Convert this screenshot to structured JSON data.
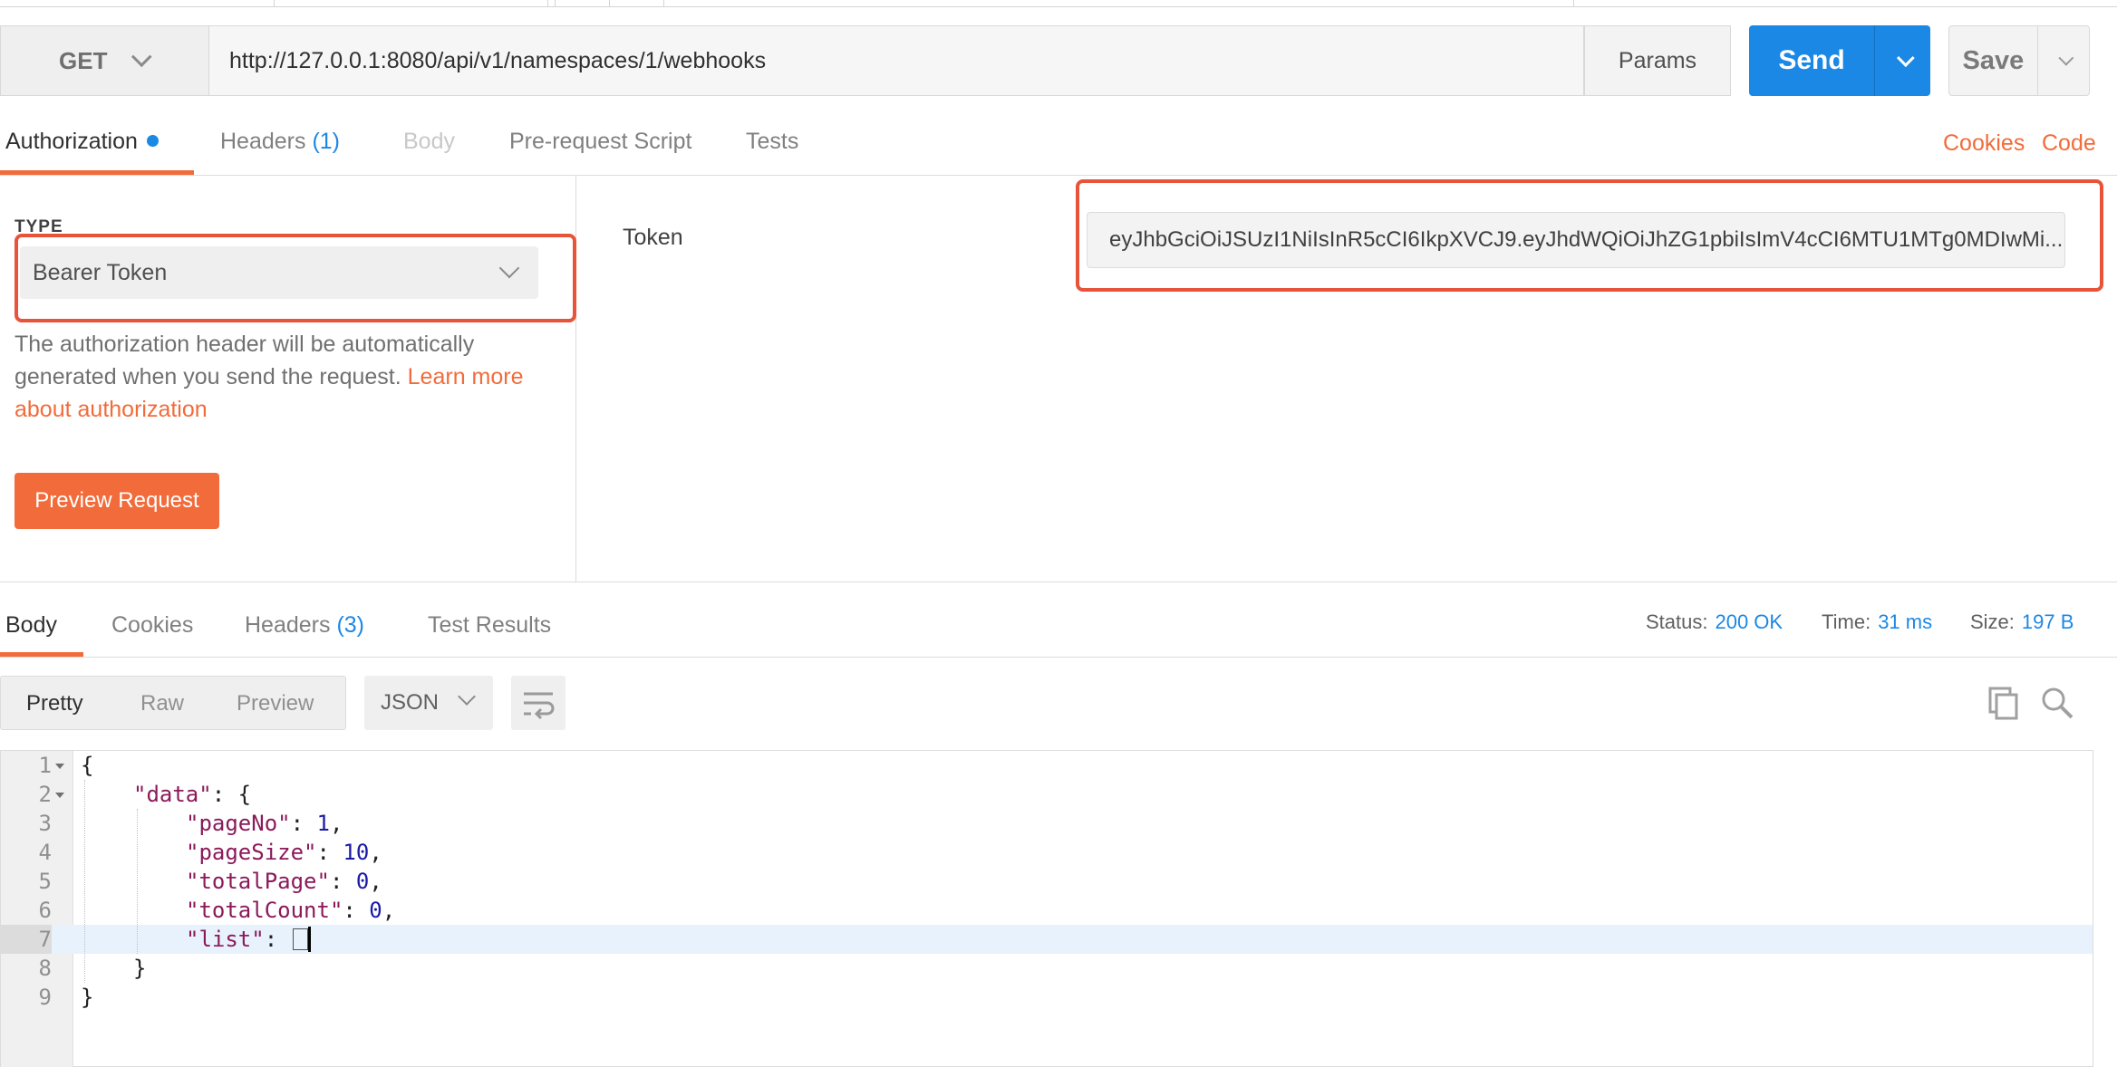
{
  "request": {
    "method": "GET",
    "url": "http://127.0.0.1:8080/api/v1/namespaces/1/webhooks",
    "params_label": "Params",
    "send_label": "Send",
    "save_label": "Save"
  },
  "request_tabs": {
    "authorization": "Authorization",
    "headers": "Headers",
    "headers_count": "(1)",
    "body": "Body",
    "prerequest": "Pre-request Script",
    "tests": "Tests",
    "cookies": "Cookies",
    "code": "Code"
  },
  "auth": {
    "type_label": "TYPE",
    "type_value": "Bearer Token",
    "description": "The authorization header will be automatically generated when you send the request.",
    "learn_more": "Learn more about authorization",
    "preview_label": "Preview Request",
    "token_label": "Token",
    "token_value": "eyJhbGciOiJSUzI1NiIsInR5cCI6IkpXVCJ9.eyJhdWQiOiJhZG1pbiIsImV4cCI6MTU1MTg0MDIwMi..."
  },
  "response_tabs": {
    "body": "Body",
    "cookies": "Cookies",
    "headers": "Headers",
    "headers_count": "(3)",
    "test_results": "Test Results"
  },
  "response_meta": {
    "status_label": "Status:",
    "status_value": "200 OK",
    "time_label": "Time:",
    "time_value": "31 ms",
    "size_label": "Size:",
    "size_value": "197 B"
  },
  "view": {
    "pretty": "Pretty",
    "raw": "Raw",
    "preview": "Preview",
    "format": "JSON"
  },
  "code": {
    "line_numbers": [
      "1",
      "2",
      "3",
      "4",
      "5",
      "6",
      "7",
      "8",
      "9"
    ],
    "l1": "{",
    "l2_key": "\"data\"",
    "l2_rest": ": {",
    "l3_key": "\"pageNo\"",
    "l3_val": "1",
    "l4_key": "\"pageSize\"",
    "l4_val": "10",
    "l5_key": "\"totalPage\"",
    "l5_val": "0",
    "l6_key": "\"totalCount\"",
    "l6_val": "0",
    "l7_key": "\"list\"",
    "l8": "}",
    "l9": "}"
  },
  "colors": {
    "accent_orange": "#f26b3a",
    "send_blue": "#1c88e5",
    "highlight_red": "#e8543a"
  },
  "icons": [
    "chevron-down-icon",
    "copy-icon",
    "search-icon",
    "wrap-lines-icon"
  ]
}
